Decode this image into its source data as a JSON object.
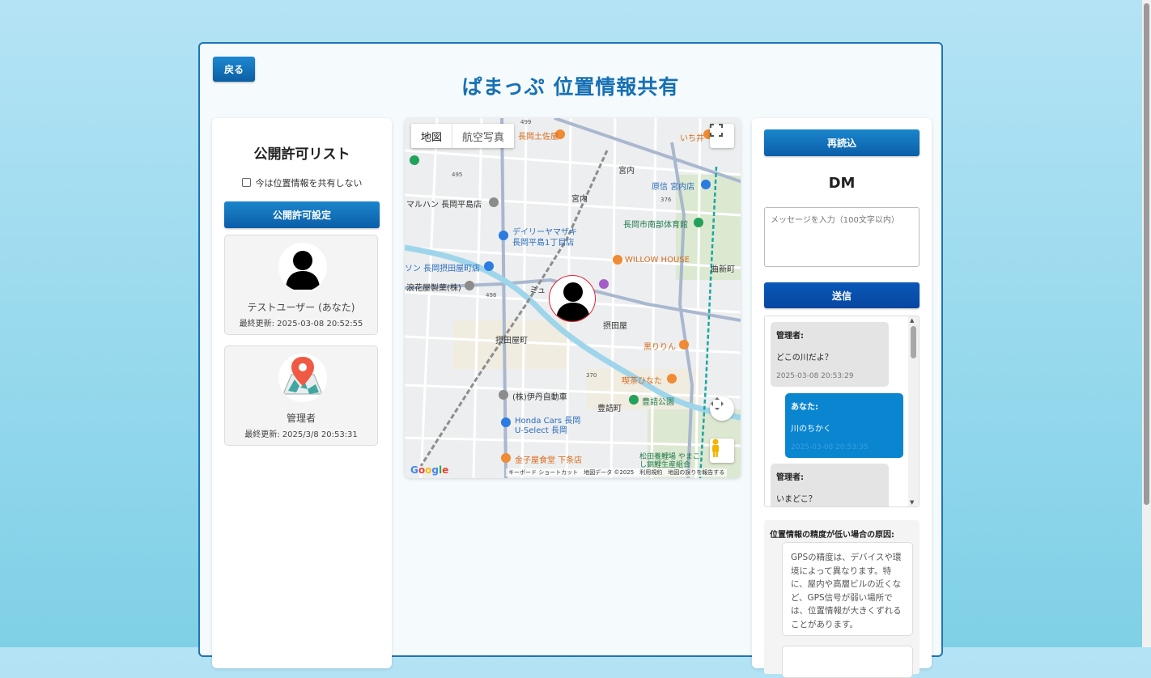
{
  "header": {
    "back_label": "戻る",
    "title": "ぱまっぷ 位置情報共有"
  },
  "left_panel": {
    "title": "公開許可リスト",
    "share_checkbox_label": "今は位置情報を共有しない",
    "settings_button": "公開許可設定",
    "users": [
      {
        "name": "テストユーザー (あなた)",
        "updated": "最終更新: 2025-03-08 20:52:55",
        "icon": "person-silhouette-icon"
      },
      {
        "name": "管理者",
        "updated": "最終更新: 2025/3/8 20:53:31",
        "icon": "map-pin-icon"
      }
    ]
  },
  "map": {
    "type_map": "地図",
    "type_satellite": "航空写真",
    "footer": "キーボード ショートカット　地図データ ©2025　利用規約　地図の誤りを報告する",
    "logo": "Google",
    "labels": [
      "長岡土佐屋",
      "いち井",
      "宮内",
      "原信 宮内店",
      "マルハン 長岡平島店",
      "宮内",
      "デイリーヤマザキ",
      "長岡平島1丁目店",
      "長岡市南部体育館",
      "ソン 長岡摂田屋町店",
      "WILLOW HOUSE",
      "曲新町",
      "浪花屋製菓(株)",
      "ミュ",
      "摂田屋",
      "摂田屋町",
      "黒りりん",
      "喫茶ひなた",
      "(株)伊丹自動車",
      "豊詰公園",
      "豊詰町",
      "Honda Cars 長岡",
      "U-Select 長岡",
      "金子屋食堂 下条店",
      "松田養鯉場 やまこし錦鯉生産組合",
      "499",
      "495",
      "376",
      "498",
      "370"
    ]
  },
  "right_panel": {
    "reload_button": "再読込",
    "dm_title": "DM",
    "message_placeholder": "メッセージを入力（100文字以内）",
    "send_button": "送信",
    "messages": [
      {
        "who": "管理者:",
        "text": "どこの川だよ？",
        "time": "2025-03-08 20:53:29"
      },
      {
        "who": "あなた:",
        "text": "川のちかく",
        "time": "2025-03-08 20:53:35"
      },
      {
        "who": "管理者:",
        "text": "いまどこ？",
        "time": ""
      }
    ],
    "accuracy_heading": "位置情報の精度が低い場合の原因:",
    "accuracy_text": "GPSの精度は、デバイスや環境によって異なります。特に、屋内や高層ビルの近くなど、GPS信号が弱い場所では、位置情報が大きくずれることがあります。"
  }
}
